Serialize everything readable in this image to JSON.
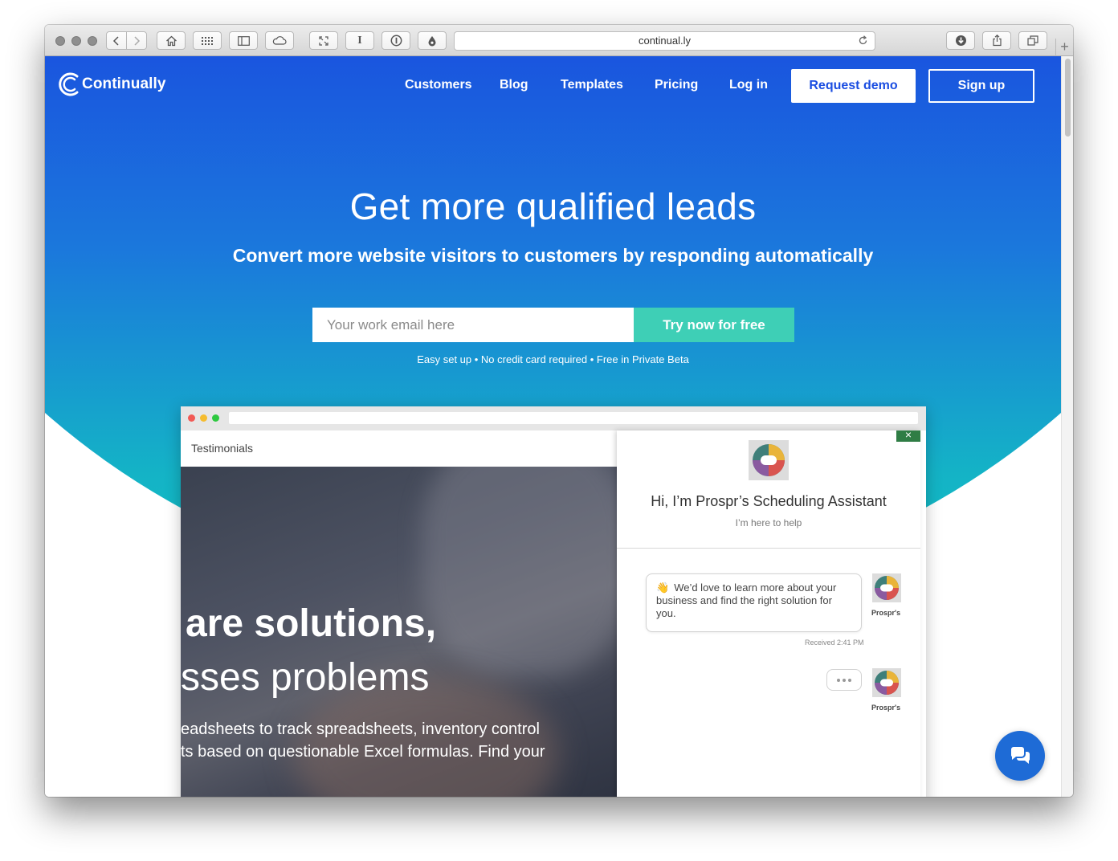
{
  "browser": {
    "url": "continual.ly"
  },
  "nav": {
    "logo_text": "Continually",
    "links": [
      "Customers",
      "Blog",
      "Templates",
      "Pricing",
      "Log in"
    ],
    "request_demo": "Request demo",
    "sign_up": "Sign up"
  },
  "hero": {
    "title": "Get more qualified leads",
    "subtitle": "Convert more website visitors to customers by responding automatically",
    "email_placeholder": "Your work email here",
    "cta": "Try now for free",
    "fineprint": "Easy set up • No credit card required • Free in Private Beta"
  },
  "mock": {
    "nav_label": "Testimonials",
    "headline_1": "are solutions,",
    "headline_2": "sses problems",
    "body_line_1": "eadsheets to track spreadsheets, inventory control",
    "body_line_2": "ts based on questionable Excel formulas. Find your"
  },
  "chat": {
    "close": "×",
    "title": "Hi, I’m Prospr’s Scheduling Assistant",
    "subtitle": "I’m here to help",
    "message": "We’d love to learn more about your business and find the right solution for you.",
    "wave_emoji": "👋",
    "received": "Received 2:41 PM",
    "agent_name": "Prospr's"
  },
  "colors": {
    "brand_blue": "#1a47e0",
    "teal_cta": "#3ecfb6",
    "launcher": "#1e6bd6"
  }
}
